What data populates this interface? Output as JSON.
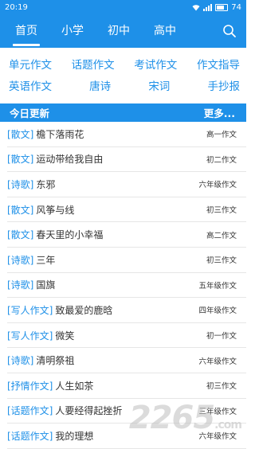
{
  "status": {
    "time": "20:19",
    "battery": "74"
  },
  "nav": {
    "tabs": [
      "首页",
      "小学",
      "初中",
      "高中"
    ],
    "active_tab": "首页",
    "search_icon": "search-icon"
  },
  "categories": [
    [
      "单元作文",
      "话题作文",
      "考试作文",
      "作文指导"
    ],
    [
      "英语作文",
      "唐诗",
      "宋词",
      "手抄报"
    ]
  ],
  "section": {
    "title": "今日更新",
    "more": "更多..."
  },
  "items": [
    {
      "tag": "[散文]",
      "title": "檐下落雨花",
      "grade": "高一作文"
    },
    {
      "tag": "[散文]",
      "title": "运动带给我自由",
      "grade": "初二作文"
    },
    {
      "tag": "[诗歌]",
      "title": "东邪",
      "grade": "六年级作文"
    },
    {
      "tag": "[散文]",
      "title": "风筝与线",
      "grade": "初三作文"
    },
    {
      "tag": "[散文]",
      "title": "春天里的小幸福",
      "grade": "高二作文"
    },
    {
      "tag": "[诗歌]",
      "title": "三年",
      "grade": "初三作文"
    },
    {
      "tag": "[诗歌]",
      "title": "国旗",
      "grade": "五年级作文"
    },
    {
      "tag": "[写人作文]",
      "title": "致最爱的鹿晗",
      "grade": "四年级作文"
    },
    {
      "tag": "[写人作文]",
      "title": "微笑",
      "grade": "初一作文"
    },
    {
      "tag": "[诗歌]",
      "title": "清明祭祖",
      "grade": "六年级作文"
    },
    {
      "tag": "[抒情作文]",
      "title": "人生如茶",
      "grade": "初三作文"
    },
    {
      "tag": "[话题作文]",
      "title": "人要经得起挫折",
      "grade": "三年级作文"
    },
    {
      "tag": "[话题作文]",
      "title": "我的理想",
      "grade": "六年级作文"
    }
  ],
  "watermark": {
    "text": "2265",
    "suffix": ".com"
  }
}
